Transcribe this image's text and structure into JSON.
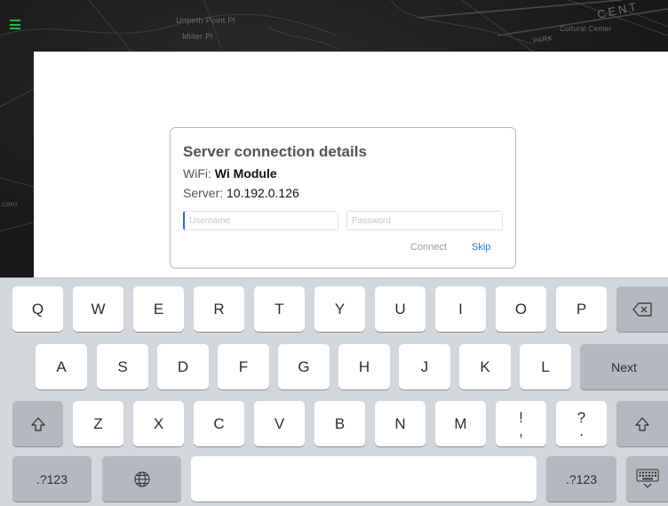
{
  "map": {
    "labels": [
      "Unpeth Point Pl",
      "Miller Pl",
      "CENT",
      "PARK",
      "Cultural Center",
      "CONT"
    ]
  },
  "dialog": {
    "title": "Server connection details",
    "wifi_label": "WiFi:",
    "wifi_value": "Wi Module",
    "server_label": "Server:",
    "server_value": "10.192.0.126",
    "username_placeholder": "Username",
    "password_placeholder": "Password",
    "connect_label": "Connect",
    "skip_label": "Skip",
    "colors": {
      "connect": "#9a9a9a",
      "skip": "#1f7bd1",
      "cursor": "#2f6bdc"
    }
  },
  "keyboard": {
    "row1": [
      "Q",
      "W",
      "E",
      "R",
      "T",
      "Y",
      "U",
      "I",
      "O",
      "P"
    ],
    "row2": [
      "A",
      "S",
      "D",
      "F",
      "G",
      "H",
      "J",
      "K",
      "L"
    ],
    "row3": [
      "Z",
      "X",
      "C",
      "V",
      "B",
      "N",
      "M"
    ],
    "punct1": [
      "!",
      ","
    ],
    "punct2": [
      "?",
      "."
    ],
    "next_label": "Next",
    "numbers_label": ".?123",
    "icons": {
      "backspace": "backspace-icon",
      "shift": "shift-icon",
      "globe": "globe-icon",
      "dismiss": "keyboard-dismiss-icon",
      "menu": "hamburger-menu-icon"
    }
  }
}
